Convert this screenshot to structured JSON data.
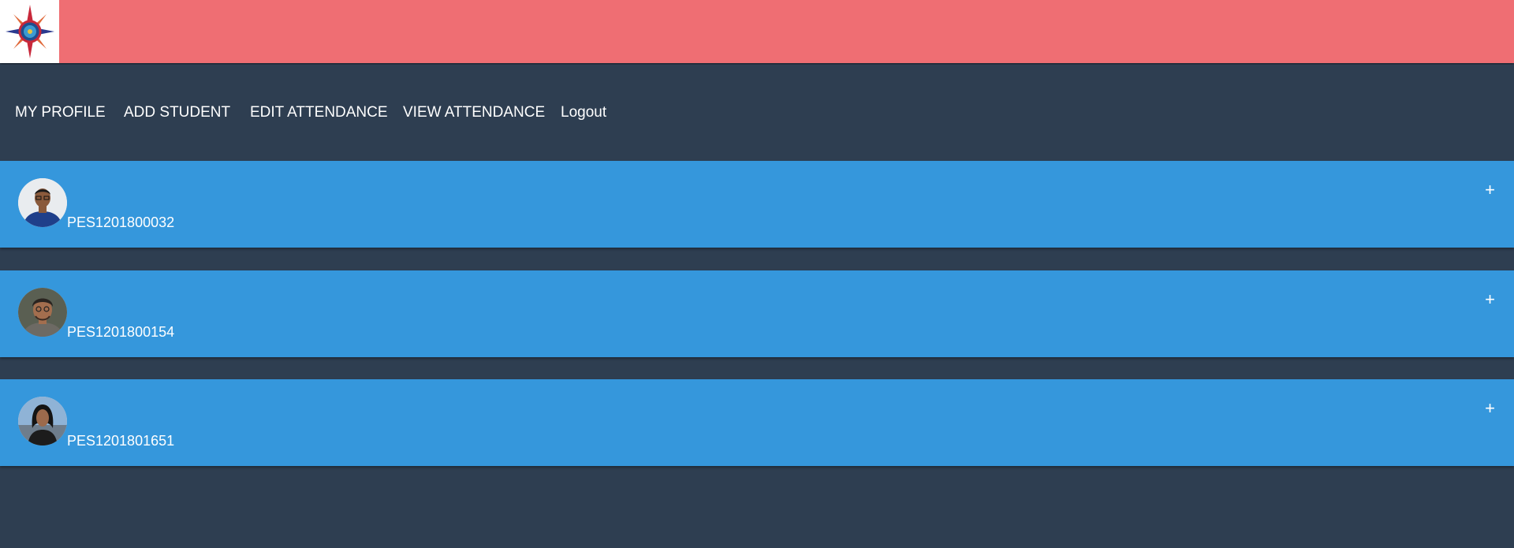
{
  "header": {
    "logo_icon": "compass-emblem-icon",
    "accent_color": "#ef6e73"
  },
  "nav": {
    "items": [
      {
        "label": "MY PROFILE"
      },
      {
        "label": "ADD STUDENT"
      },
      {
        "label": "EDIT ATTENDANCE"
      },
      {
        "label": "VIEW ATTENDANCE"
      },
      {
        "label": "Logout"
      }
    ]
  },
  "students": [
    {
      "id": "PES1201800032",
      "expand_symbol": "+",
      "avatar_icon": "student-photo"
    },
    {
      "id": "PES1201800154",
      "expand_symbol": "+",
      "avatar_icon": "student-photo"
    },
    {
      "id": "PES1201801651",
      "expand_symbol": "+",
      "avatar_icon": "student-photo"
    }
  ],
  "colors": {
    "background": "#2e3e51",
    "card": "#3597dc",
    "text": "#ffffff"
  }
}
